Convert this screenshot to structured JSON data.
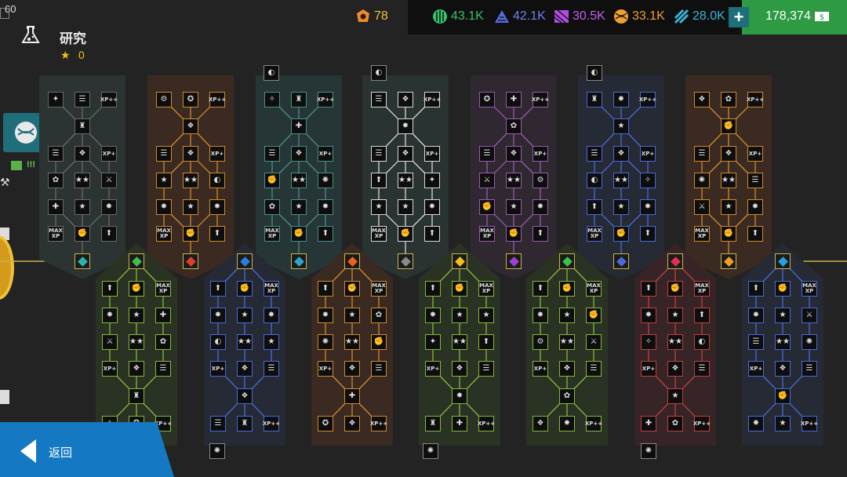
{
  "status": {
    "fps": "60"
  },
  "header": {
    "title": "研究",
    "stars": "0"
  },
  "resources": {
    "coins": "78",
    "r1": "43.1K",
    "r2": "42.1K",
    "r3": "30.5K",
    "r4": "33.1K",
    "r5": "28.0K",
    "cash": "178,374"
  },
  "colors": {
    "coins": "#f08a2c",
    "r1": "#37c26b",
    "r2": "#5a6ae0",
    "r3": "#b04ee0",
    "r4": "#f0a030",
    "r5": "#3bb6d8",
    "cash_bg": "#2e9a44",
    "accent_teal": "#1f6f7a",
    "back_bg": "#1479c2",
    "gold_line": "#c9b54a",
    "green_line": "#7cc23a",
    "red_line": "#c03030"
  },
  "side": {
    "alert": "!!!"
  },
  "footer": {
    "back_label": "返回"
  },
  "tree": {
    "top_columns": [
      "gray",
      "orange",
      "teal",
      "white",
      "purple",
      "blue",
      "orange"
    ],
    "bottom_columns": [
      "green",
      "blue",
      "orange",
      "green",
      "green",
      "red",
      "blue"
    ],
    "top_gems": [
      {
        "color": "#2bb3b0"
      },
      {
        "color": "#e03c2c"
      },
      {
        "color": "#2aa7c9"
      },
      {
        "color": "#8a8a8a"
      },
      {
        "color": "#a040d0"
      },
      {
        "color": "#4a6ad8"
      },
      {
        "color": "#f0a020"
      }
    ],
    "bottom_gems": [
      {
        "color": "#3cc24a"
      },
      {
        "color": "#2a80d8"
      },
      {
        "color": "#f06020"
      },
      {
        "color": "#f0c020"
      },
      {
        "color": "#3cc24a"
      },
      {
        "color": "#e03050"
      },
      {
        "color": "#2aa0e0"
      }
    ],
    "node_labels": {
      "xp": "XP",
      "xp_plus": "XP+",
      "xp_pp": "XP++",
      "max": "MAX",
      "max_xp": "MAX XP"
    }
  }
}
